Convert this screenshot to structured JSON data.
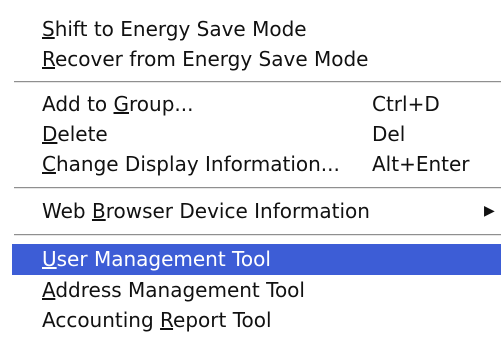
{
  "menu": {
    "cutoff_text": "…",
    "items": [
      {
        "label_pre": "",
        "mnemonic": "S",
        "label_post": "hift to Energy Save Mode",
        "shortcut": ""
      },
      {
        "label_pre": "",
        "mnemonic": "R",
        "label_post": "ecover from Energy Save Mode",
        "shortcut": ""
      },
      {
        "label_pre": "Add to ",
        "mnemonic": "G",
        "label_post": "roup...",
        "shortcut": "Ctrl+D"
      },
      {
        "label_pre": "",
        "mnemonic": "D",
        "label_post": "elete",
        "shortcut": "Del"
      },
      {
        "label_pre": "",
        "mnemonic": "C",
        "label_post": "hange Display Information...",
        "shortcut": "Alt+Enter"
      },
      {
        "label_pre": "Web ",
        "mnemonic": "B",
        "label_post": "rowser Device Information",
        "shortcut": "",
        "submenu_arrow": "▶"
      },
      {
        "label_pre": "",
        "mnemonic": "U",
        "label_post": "ser Management Tool",
        "shortcut": ""
      },
      {
        "label_pre": "",
        "mnemonic": "A",
        "label_post": "ddress Management Tool",
        "shortcut": ""
      },
      {
        "label_pre": "Accounting ",
        "mnemonic": "R",
        "label_post": "eport Tool",
        "shortcut": ""
      }
    ],
    "selected_index": 6,
    "highlight_color": "#3d5dd6"
  }
}
